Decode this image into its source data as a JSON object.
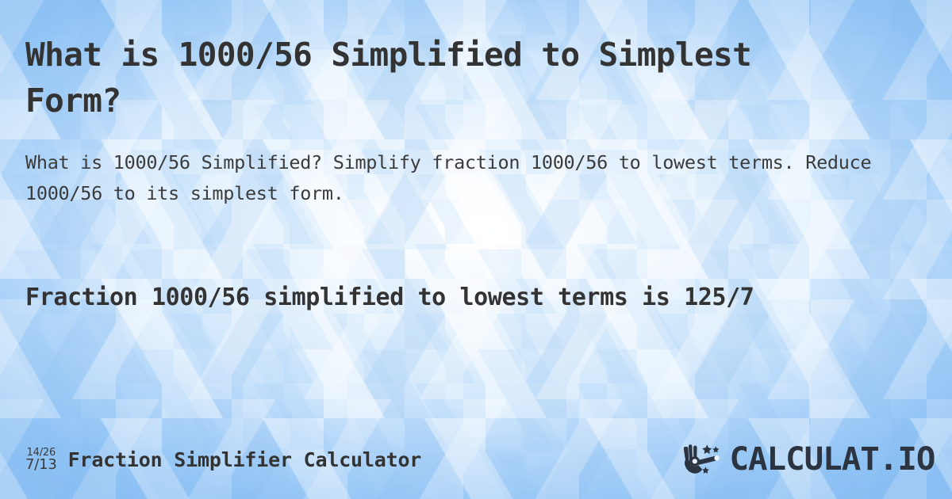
{
  "page": {
    "title": "What is 1000/56 Simplified to Simplest Form?",
    "subtitle": "What is 1000/56 Simplified? Simplify fraction 1000/56 to lowest terms. Reduce 1000/56 to its simplest form.",
    "result": "Fraction 1000/56 simplified to lowest terms is 125/7"
  },
  "fraction": {
    "original": "1000/56",
    "numerator": "1000",
    "denominator": "56",
    "simplified": "125/7",
    "simplified_numerator": "125",
    "simplified_denominator": "7"
  },
  "footer": {
    "icon": {
      "name": "fraction-simplify-icon",
      "top_fraction": "14/26",
      "bottom_fraction": "7/13"
    },
    "tool_name": "Fraction Simplifier Calculator",
    "brand": {
      "name": "CALCULAT.IO",
      "icon_name": "magic-wand-hand-icon"
    }
  },
  "colors": {
    "text": "#333333",
    "subtitle_text": "#3b3b3b",
    "brand_text": "#2b3440",
    "background_center": "#ffffff",
    "background_edge": "#9ccbf7",
    "background_base": "#bcdcfb"
  }
}
